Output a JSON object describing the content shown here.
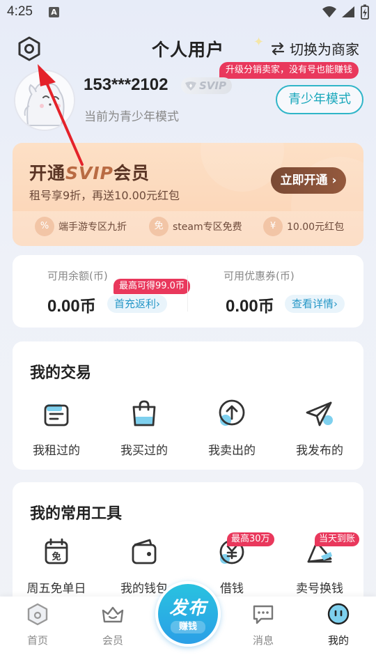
{
  "status_bar": {
    "time": "4:25",
    "notification_glyph": "A"
  },
  "header": {
    "title": "个人用户",
    "switch_label": "切换为商家",
    "promo_tag": "升级分销卖家，没有号也能赚钱"
  },
  "profile": {
    "username": "153***2102",
    "badge": "SVIP",
    "mode_text": "当前为青少年模式",
    "youth_mode_button": "青少年模式"
  },
  "svip_card": {
    "title_prefix": "开通",
    "title_svip": "SVIP",
    "title_suffix": "会员",
    "subtitle": "租号享9折，再送10.00元红包",
    "open_button": "立即开通",
    "benefits": [
      {
        "label": "端手游专区九折",
        "icon": "discount-icon"
      },
      {
        "label": "steam专区免费",
        "icon": "free-icon"
      },
      {
        "label": "10.00元红包",
        "icon": "red-packet-icon"
      }
    ]
  },
  "balance": {
    "balance_label": "可用余额(币)",
    "balance_value": "0.00",
    "balance_unit": "币",
    "balance_tag": "最高可得99.0币",
    "balance_link": "首充返利",
    "coupon_label": "可用优惠券(币)",
    "coupon_value": "0.00",
    "coupon_unit": "币",
    "coupon_link": "查看详情"
  },
  "transactions": {
    "title": "我的交易",
    "items": [
      {
        "label": "我租过的",
        "icon": "rented-icon"
      },
      {
        "label": "我买过的",
        "icon": "bought-bag-icon"
      },
      {
        "label": "我卖出的",
        "icon": "sold-upload-icon"
      },
      {
        "label": "我发布的",
        "icon": "published-send-icon"
      }
    ]
  },
  "tools": {
    "title": "我的常用工具",
    "items": [
      {
        "label": "周五免单日",
        "icon": "free-order-calendar-icon",
        "badge": ""
      },
      {
        "label": "我的钱包",
        "icon": "wallet-icon",
        "badge": ""
      },
      {
        "label": "借钱",
        "icon": "loan-yuan-icon",
        "badge": "最高30万"
      },
      {
        "label": "卖号换钱",
        "icon": "sell-account-icon",
        "badge": "当天到账"
      }
    ]
  },
  "bottom_nav": {
    "items": [
      {
        "label": "首页",
        "icon": "home-icon"
      },
      {
        "label": "会员",
        "icon": "member-crown-icon"
      },
      {
        "label": "消息",
        "icon": "message-icon"
      },
      {
        "label": "我的",
        "icon": "profile-face-icon"
      }
    ],
    "publish_main": "发布",
    "publish_sub": "赚钱"
  },
  "colors": {
    "accent_teal": "#2fb5c8",
    "promo_red": "#e9385c",
    "svip_brown": "#7a4a34",
    "publish_blue": "#2b9fe6",
    "annotation_red": "#e4222a"
  }
}
